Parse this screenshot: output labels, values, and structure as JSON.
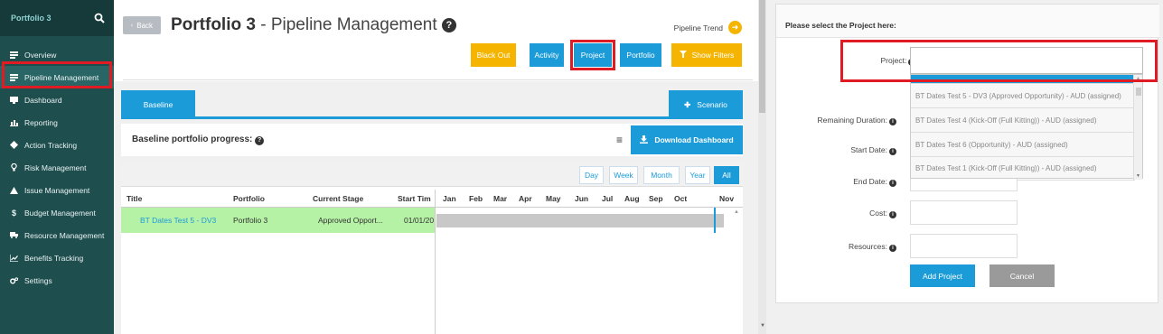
{
  "sidebar": {
    "title": "Portfolio 3",
    "items": [
      {
        "label": "Overview",
        "icon": "list-icon"
      },
      {
        "label": "Pipeline Management",
        "icon": "list-icon"
      },
      {
        "label": "Dashboard",
        "icon": "monitor-icon"
      },
      {
        "label": "Reporting",
        "icon": "bar-chart-icon"
      },
      {
        "label": "Action Tracking",
        "icon": "diamond-icon"
      },
      {
        "label": "Risk Management",
        "icon": "lightbulb-icon"
      },
      {
        "label": "Issue Management",
        "icon": "warning-icon"
      },
      {
        "label": "Budget Management",
        "icon": "dollar-icon"
      },
      {
        "label": "Resource Management",
        "icon": "truck-icon"
      },
      {
        "label": "Benefits Tracking",
        "icon": "line-chart-icon"
      },
      {
        "label": "Settings",
        "icon": "gears-icon"
      }
    ]
  },
  "header": {
    "back_label": "Back",
    "title_bold": "Portfolio 3",
    "title_rest": " - Pipeline Management ",
    "help_glyph": "?",
    "trend_label": "Pipeline Trend",
    "buttons": {
      "blackout": "Black Out",
      "activity": "Activity",
      "project": "Project",
      "portfolio": "Portfolio",
      "filters": "Show Filters"
    }
  },
  "tabs": {
    "baseline": "Baseline",
    "scenario": "Scenario"
  },
  "progress": {
    "title": "Baseline portfolio progress:",
    "download": "Download Dashboard"
  },
  "periods": [
    "Day",
    "Week",
    "Month",
    "Year",
    "All"
  ],
  "table": {
    "columns": [
      "Title",
      "Portfolio",
      "Current Stage",
      "Start Tim"
    ],
    "months": [
      "Jan",
      "Feb",
      "Mar",
      "Apr",
      "May",
      "Jun",
      "Jul",
      "Aug",
      "Sep",
      "Oct",
      "Nov"
    ],
    "rows": [
      {
        "title": "BT Dates Test 5 - DV3",
        "portfolio": "Portfolio 3",
        "stage": "Approved Opport...",
        "start": "01/01/20"
      }
    ]
  },
  "modal": {
    "title": "Please select the Project here:",
    "fields": {
      "project": "Project:",
      "remaining": "Remaining Duration:",
      "start": "Start Date:",
      "end": "End Date:",
      "cost": "Cost:",
      "resources": "Resources:"
    },
    "required_mark": "*",
    "dropdown_options": [
      "BT Dates Test 5 - DV3 (Approved Opportunity) - AUD (assigned)",
      "BT Dates Test 4 (Kick-Off (Full Kitting)) - AUD (assigned)",
      "BT Dates Test 6 (Opportunity) - AUD (assigned)",
      "BT Dates Test 1 (Kick-Off (Full Kitting)) - AUD (assigned)"
    ],
    "add_label": "Add Project",
    "cancel_label": "Cancel"
  },
  "colors": {
    "accent": "#1b9bd8",
    "sidebar": "#1f4e4f",
    "warning": "#f4b400",
    "highlight": "#e01b24",
    "row_highlight": "#b6f2a6"
  }
}
